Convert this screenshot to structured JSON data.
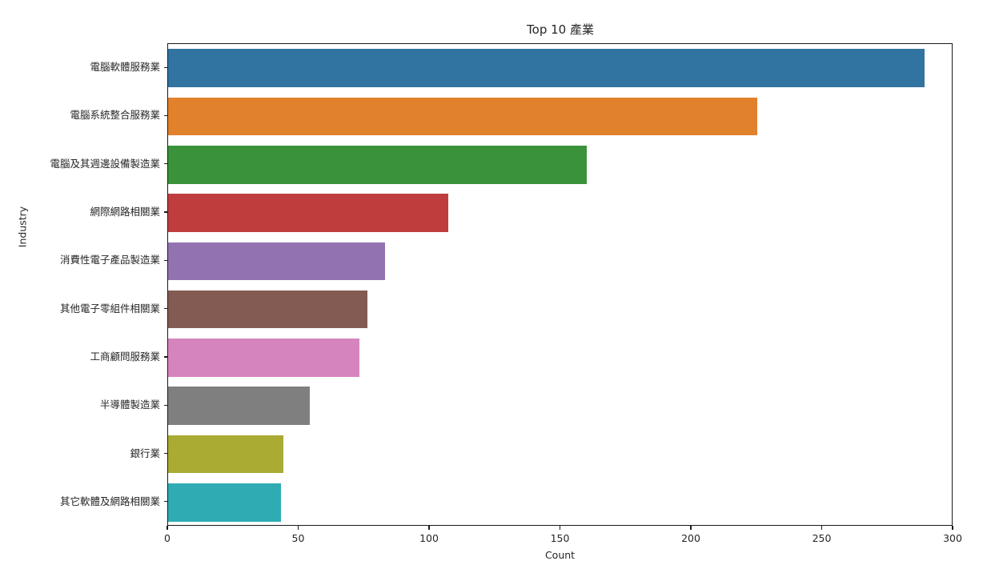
{
  "chart_data": {
    "type": "bar",
    "orientation": "horizontal",
    "title": "Top 10 產業",
    "xlabel": "Count",
    "ylabel": "Industry",
    "xlim": [
      0,
      300
    ],
    "ylim_categories": 10,
    "grid": false,
    "legend": null,
    "xticks": [
      "0",
      "50",
      "100",
      "150",
      "200",
      "250",
      "300"
    ],
    "xtick_values": [
      0,
      50,
      100,
      150,
      200,
      250,
      300
    ],
    "categories": [
      "電腦軟體服務業",
      "電腦系統整合服務業",
      "電腦及其週邊設備製造業",
      "網際網路相關業",
      "消費性電子產品製造業",
      "其他電子零組件相關業",
      "工商顧問服務業",
      "半導體製造業",
      "銀行業",
      "其它軟體及網路相關業"
    ],
    "values": [
      289,
      225,
      160,
      107,
      83,
      76,
      73,
      54,
      44,
      43
    ],
    "colors": [
      "#3274a1",
      "#e1812c",
      "#3a923a",
      "#c03d3e",
      "#9372b2",
      "#845b53",
      "#d684bd",
      "#7f7f7f",
      "#a9ab33",
      "#2fabb3"
    ]
  }
}
